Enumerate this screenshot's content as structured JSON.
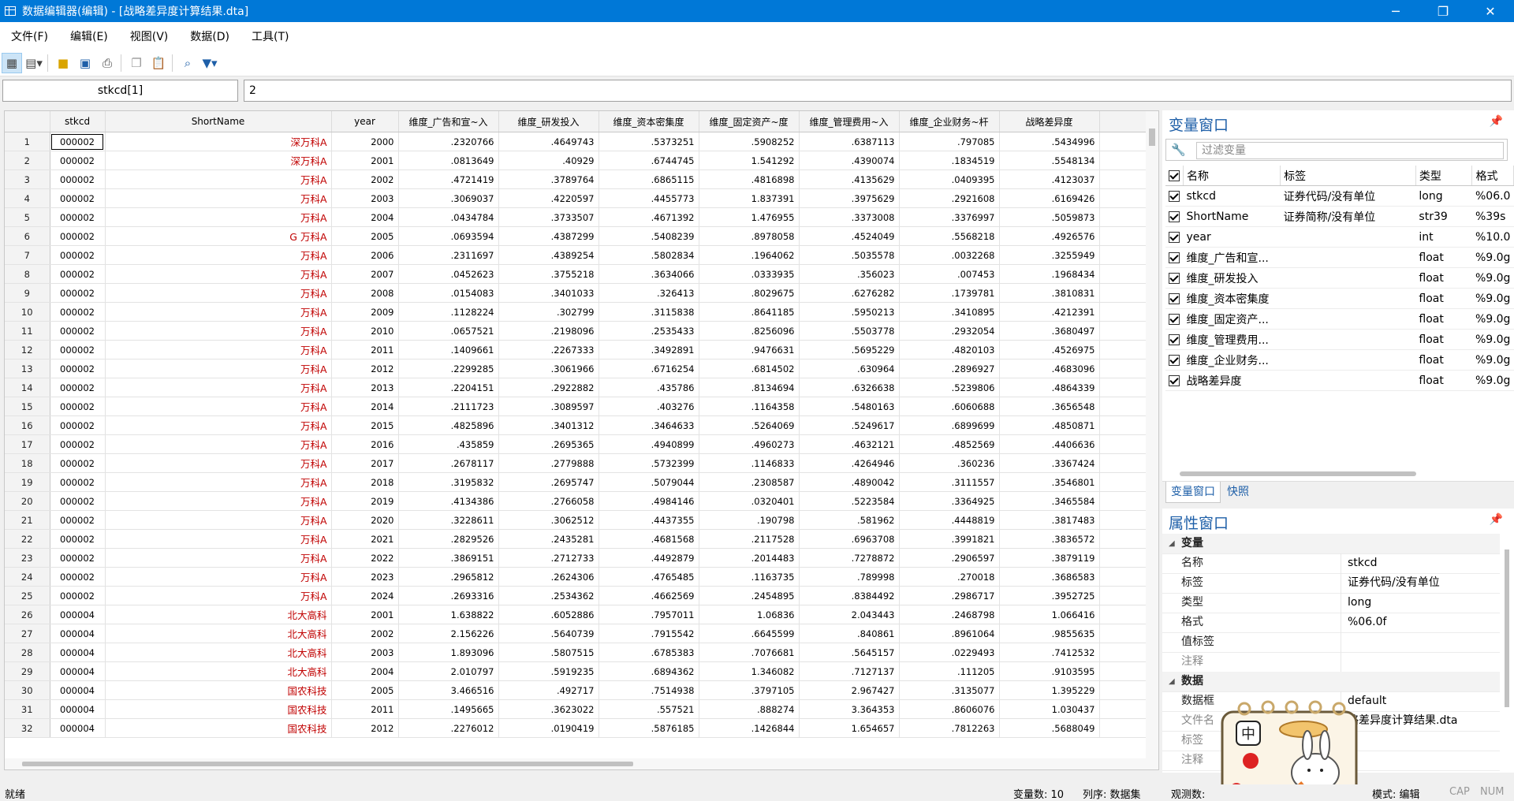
{
  "window": {
    "title": "数据编辑器(编辑) - [战略差异度计算结果.dta]",
    "controls": {
      "minimize": "─",
      "maximize": "❐",
      "close": "✕"
    }
  },
  "menu": [
    "文件(F)",
    "编辑(E)",
    "视图(V)",
    "数据(D)",
    "工具(T)"
  ],
  "toolbar": {
    "icons": [
      "edit-mode-icon",
      "browse-mode-icon",
      "open-folder-icon",
      "save-icon",
      "print-icon",
      "copy-icon",
      "paste-icon",
      "search-icon",
      "filter-icon"
    ]
  },
  "editbar": {
    "cell_ref": "stkcd[1]",
    "cell_value": "2"
  },
  "grid": {
    "columns": [
      "stkcd",
      "ShortName",
      "year",
      "维度_广告和宣~入",
      "维度_研发投入",
      "维度_资本密集度",
      "维度_固定资产~度",
      "维度_管理费用~入",
      "维度_企业财务~杆",
      "战略差异度"
    ],
    "rows": [
      [
        "1",
        "000002",
        "深万科A",
        "2000",
        ".2320766",
        ".4649743",
        ".5373251",
        ".5908252",
        ".6387113",
        ".797085",
        ".5434996"
      ],
      [
        "2",
        "000002",
        "深万科A",
        "2001",
        ".0813649",
        ".40929",
        ".6744745",
        "1.541292",
        ".4390074",
        ".1834519",
        ".5548134"
      ],
      [
        "3",
        "000002",
        "万科A",
        "2002",
        ".4721419",
        ".3789764",
        ".6865115",
        ".4816898",
        ".4135629",
        ".0409395",
        ".4123037"
      ],
      [
        "4",
        "000002",
        "万科A",
        "2003",
        ".3069037",
        ".4220597",
        ".4455773",
        "1.837391",
        ".3975629",
        ".2921608",
        ".6169426"
      ],
      [
        "5",
        "000002",
        "万科A",
        "2004",
        ".0434784",
        ".3733507",
        ".4671392",
        "1.476955",
        ".3373008",
        ".3376997",
        ".5059873"
      ],
      [
        "6",
        "000002",
        "G 万科A",
        "2005",
        ".0693594",
        ".4387299",
        ".5408239",
        ".8978058",
        ".4524049",
        ".5568218",
        ".4926576"
      ],
      [
        "7",
        "000002",
        "万科A",
        "2006",
        ".2311697",
        ".4389254",
        ".5802834",
        ".1964062",
        ".5035578",
        ".0032268",
        ".3255949"
      ],
      [
        "8",
        "000002",
        "万科A",
        "2007",
        ".0452623",
        ".3755218",
        ".3634066",
        ".0333935",
        ".356023",
        ".007453",
        ".1968434"
      ],
      [
        "9",
        "000002",
        "万科A",
        "2008",
        ".0154083",
        ".3401033",
        ".326413",
        ".8029675",
        ".6276282",
        ".1739781",
        ".3810831"
      ],
      [
        "10",
        "000002",
        "万科A",
        "2009",
        ".1128224",
        ".302799",
        ".3115838",
        ".8641185",
        ".5950213",
        ".3410895",
        ".4212391"
      ],
      [
        "11",
        "000002",
        "万科A",
        "2010",
        ".0657521",
        ".2198096",
        ".2535433",
        ".8256096",
        ".5503778",
        ".2932054",
        ".3680497"
      ],
      [
        "12",
        "000002",
        "万科A",
        "2011",
        ".1409661",
        ".2267333",
        ".3492891",
        ".9476631",
        ".5695229",
        ".4820103",
        ".4526975"
      ],
      [
        "13",
        "000002",
        "万科A",
        "2012",
        ".2299285",
        ".3061966",
        ".6716254",
        ".6814502",
        ".630964",
        ".2896927",
        ".4683096"
      ],
      [
        "14",
        "000002",
        "万科A",
        "2013",
        ".2204151",
        ".2922882",
        ".435786",
        ".8134694",
        ".6326638",
        ".5239806",
        ".4864339"
      ],
      [
        "15",
        "000002",
        "万科A",
        "2014",
        ".2111723",
        ".3089597",
        ".403276",
        ".1164358",
        ".5480163",
        ".6060688",
        ".3656548"
      ],
      [
        "16",
        "000002",
        "万科A",
        "2015",
        ".4825896",
        ".3401312",
        ".3464633",
        ".5264069",
        ".5249617",
        ".6899699",
        ".4850871"
      ],
      [
        "17",
        "000002",
        "万科A",
        "2016",
        ".435859",
        ".2695365",
        ".4940899",
        ".4960273",
        ".4632121",
        ".4852569",
        ".4406636"
      ],
      [
        "18",
        "000002",
        "万科A",
        "2017",
        ".2678117",
        ".2779888",
        ".5732399",
        ".1146833",
        ".4264946",
        ".360236",
        ".3367424"
      ],
      [
        "19",
        "000002",
        "万科A",
        "2018",
        ".3195832",
        ".2695747",
        ".5079044",
        ".2308587",
        ".4890042",
        ".3111557",
        ".3546801"
      ],
      [
        "20",
        "000002",
        "万科A",
        "2019",
        ".4134386",
        ".2766058",
        ".4984146",
        ".0320401",
        ".5223584",
        ".3364925",
        ".3465584"
      ],
      [
        "21",
        "000002",
        "万科A",
        "2020",
        ".3228611",
        ".3062512",
        ".4437355",
        ".190798",
        ".581962",
        ".4448819",
        ".3817483"
      ],
      [
        "22",
        "000002",
        "万科A",
        "2021",
        ".2829526",
        ".2435281",
        ".4681568",
        ".2117528",
        ".6963708",
        ".3991821",
        ".3836572"
      ],
      [
        "23",
        "000002",
        "万科A",
        "2022",
        ".3869151",
        ".2712733",
        ".4492879",
        ".2014483",
        ".7278872",
        ".2906597",
        ".3879119"
      ],
      [
        "24",
        "000002",
        "万科A",
        "2023",
        ".2965812",
        ".2624306",
        ".4765485",
        ".1163735",
        ".789998",
        ".270018",
        ".3686583"
      ],
      [
        "25",
        "000002",
        "万科A",
        "2024",
        ".2693316",
        ".2534362",
        ".4662569",
        ".2454895",
        ".8384492",
        ".2986717",
        ".3952725"
      ],
      [
        "26",
        "000004",
        "北大高科",
        "2001",
        "1.638822",
        ".6052886",
        ".7957011",
        "1.06836",
        "2.043443",
        ".2468798",
        "1.066416"
      ],
      [
        "27",
        "000004",
        "北大高科",
        "2002",
        "2.156226",
        ".5640739",
        ".7915542",
        ".6645599",
        ".840861",
        ".8961064",
        ".9855635"
      ],
      [
        "28",
        "000004",
        "北大高科",
        "2003",
        "1.893096",
        ".5807515",
        ".6785383",
        ".7076681",
        ".5645157",
        ".0229493",
        ".7412532"
      ],
      [
        "29",
        "000004",
        "北大高科",
        "2004",
        "2.010797",
        ".5919235",
        ".6894362",
        "1.346082",
        ".7127137",
        ".111205",
        ".9103595"
      ],
      [
        "30",
        "000004",
        "国农科技",
        "2005",
        "3.466516",
        ".492717",
        ".7514938",
        ".3797105",
        "2.967427",
        ".3135077",
        "1.395229"
      ],
      [
        "31",
        "000004",
        "国农科技",
        "2011",
        ".1495665",
        ".3623022",
        ".557521",
        ".888274",
        "3.364353",
        ".8606076",
        "1.030437"
      ],
      [
        "32",
        "000004",
        "国农科技",
        "2012",
        ".2276012",
        ".0190419",
        ".5876185",
        ".1426844",
        "1.654657",
        ".7812263",
        ".5688049"
      ]
    ]
  },
  "variables_panel": {
    "title": "变量窗口",
    "filter_placeholder": "过滤变量",
    "headers": [
      "名称",
      "标签",
      "类型",
      "格式"
    ],
    "rows": [
      [
        "stkcd",
        "证券代码/没有单位",
        "long",
        "%06.0"
      ],
      [
        "ShortName",
        "证券简称/没有单位",
        "str39",
        "%39s"
      ],
      [
        "year",
        "",
        "int",
        "%10.0"
      ],
      [
        "维度_广告和宣...",
        "",
        "float",
        "%9.0g"
      ],
      [
        "维度_研发投入",
        "",
        "float",
        "%9.0g"
      ],
      [
        "维度_资本密集度",
        "",
        "float",
        "%9.0g"
      ],
      [
        "维度_固定资产...",
        "",
        "float",
        "%9.0g"
      ],
      [
        "维度_管理费用...",
        "",
        "float",
        "%9.0g"
      ],
      [
        "维度_企业财务...",
        "",
        "float",
        "%9.0g"
      ],
      [
        "战略差异度",
        "",
        "float",
        "%9.0g"
      ]
    ],
    "tabs": [
      "变量窗口",
      "快照"
    ]
  },
  "properties_panel": {
    "title": "属性窗口",
    "section_variable": "变量",
    "variable_props": [
      {
        "k": "名称",
        "v": "stkcd"
      },
      {
        "k": "标签",
        "v": "证券代码/没有单位"
      },
      {
        "k": "类型",
        "v": "long"
      },
      {
        "k": "格式",
        "v": "%06.0f"
      },
      {
        "k": "值标签",
        "v": ""
      },
      {
        "k": "注释",
        "v": ""
      }
    ],
    "section_data": "数据",
    "data_props": [
      {
        "k": "数据框",
        "v": "default"
      },
      {
        "k": "文件名",
        "v": "略差异度计算结果.dta"
      },
      {
        "k": "标签",
        "v": ""
      },
      {
        "k": "注释",
        "v": ""
      },
      {
        "k": "变量",
        "v": ""
      }
    ]
  },
  "statusbar": {
    "ready": "就绪",
    "var_count": "变量数: 10",
    "order": "列序: 数据集",
    "obs_count": "观测数:",
    "mode": "模式: 编辑",
    "cap": "CAP",
    "num": "NUM"
  },
  "colors": {
    "titlebar": "#0078d7",
    "string_cell": "#c00000",
    "panel_title": "#1e5fa8"
  }
}
